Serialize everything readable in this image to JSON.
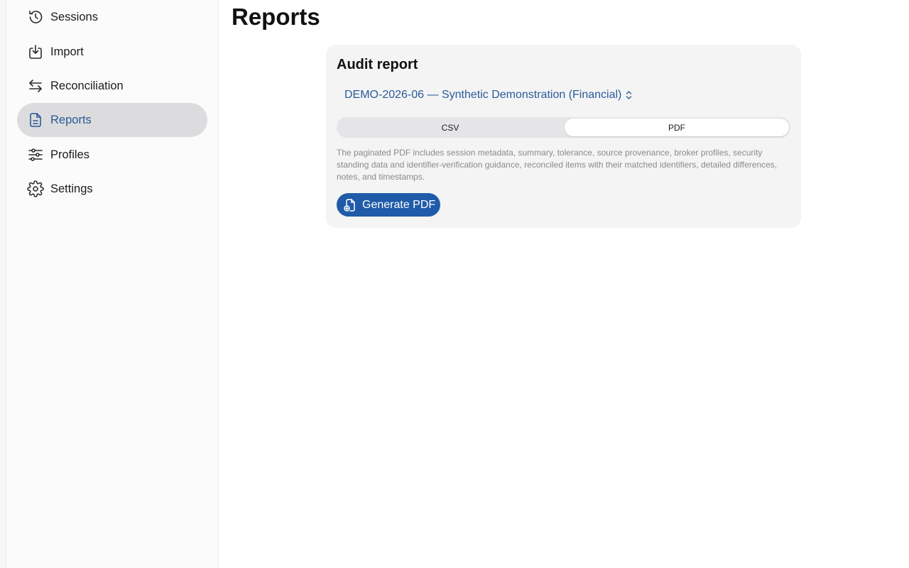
{
  "sidebar": {
    "items": [
      {
        "label": "Sessions",
        "icon": "clock-history-icon",
        "active": false
      },
      {
        "label": "Import",
        "icon": "tray-download-icon",
        "active": false
      },
      {
        "label": "Reconciliation",
        "icon": "arrows-left-right-icon",
        "active": false
      },
      {
        "label": "Reports",
        "icon": "document-icon",
        "active": true
      },
      {
        "label": "Profiles",
        "icon": "sliders-icon",
        "active": false
      },
      {
        "label": "Settings",
        "icon": "gear-icon",
        "active": false
      }
    ]
  },
  "main": {
    "title": "Reports",
    "card": {
      "title": "Audit report",
      "session_selector": "DEMO-2026-06 — Synthetic Demonstration (Financial)",
      "formats": [
        {
          "label": "CSV",
          "selected": false
        },
        {
          "label": "PDF",
          "selected": true
        }
      ],
      "description": "The paginated PDF includes session metadata, summary, tolerance, source provenance, broker profiles, security standing data and identifier-verification guidance, reconciled items with their matched identifiers, detailed differences, notes, and timestamps.",
      "generate_label": "Generate PDF",
      "generate_icon": "document-plus-icon"
    }
  },
  "colors": {
    "accent": "#2a5a97",
    "button": "#1f5ba8",
    "selected_nav_bg": "#dcdcde",
    "card_bg": "#f4f4f5"
  }
}
